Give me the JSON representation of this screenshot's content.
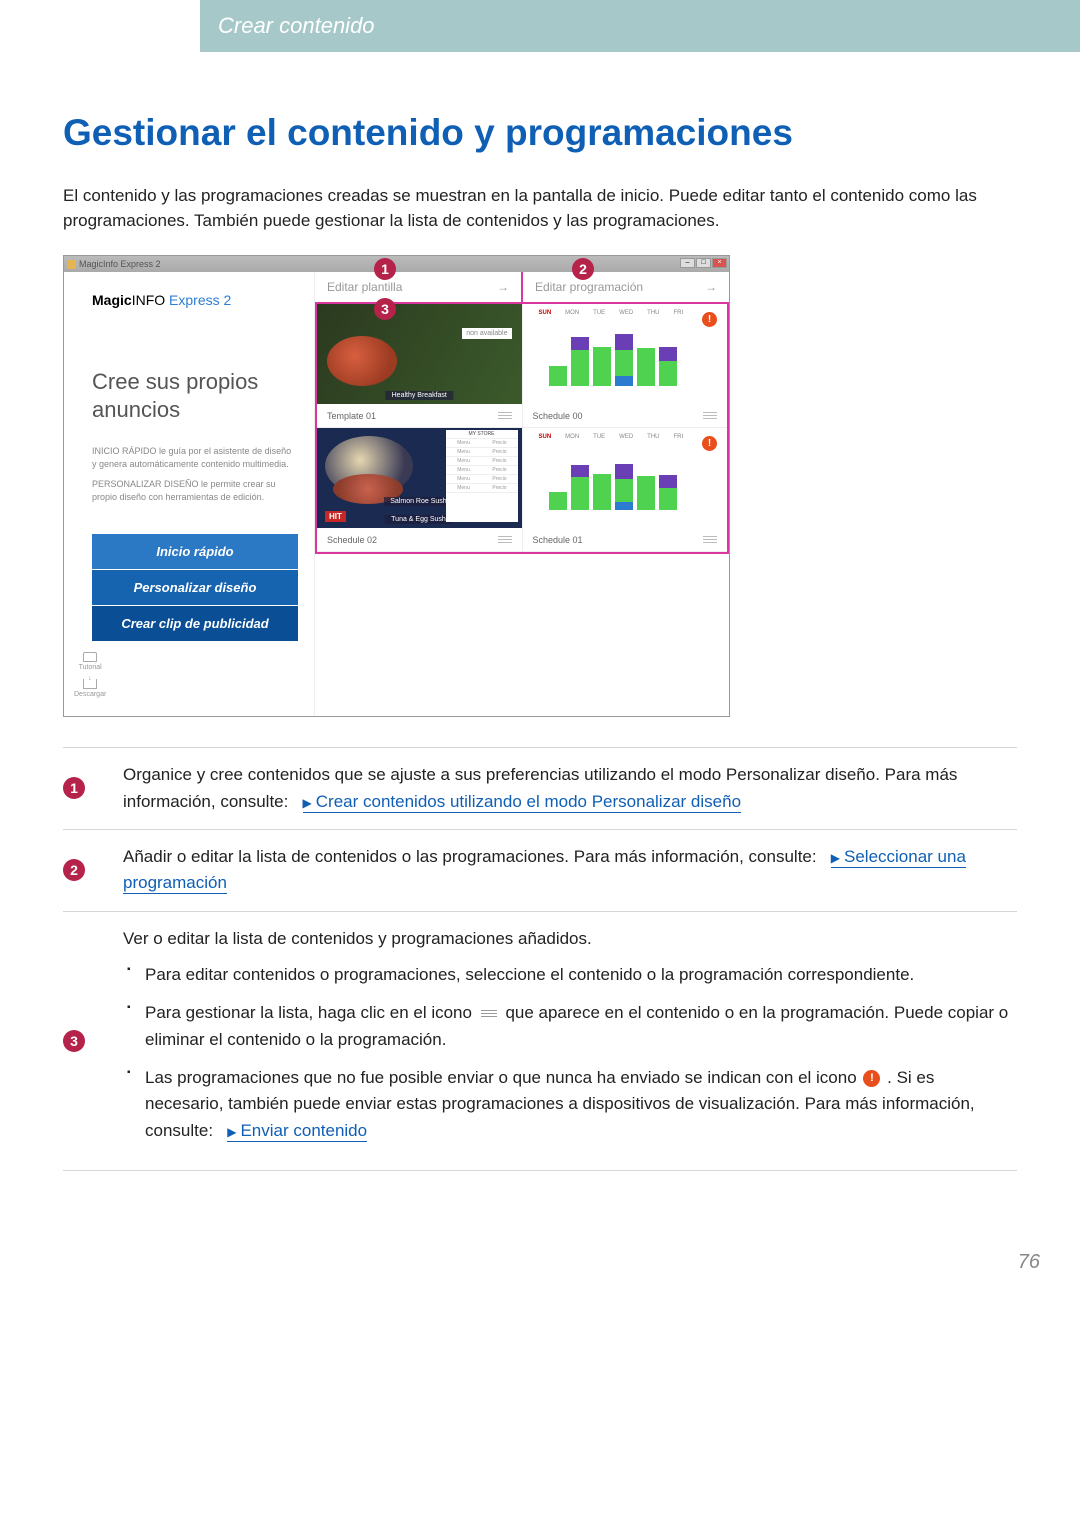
{
  "header": {
    "breadcrumb": "Crear contenido"
  },
  "page": {
    "title": "Gestionar el contenido y programaciones",
    "intro": "El contenido y las programaciones creadas se muestran en la pantalla de inicio. Puede editar tanto el contenido como las programaciones. También puede gestionar la lista de contenidos y las programaciones.",
    "number": "76"
  },
  "screenshot": {
    "titlebar": "MagicInfo Express 2",
    "logo_bold": "Magic",
    "logo_mid": "INFO",
    "logo_brand": " Express 2",
    "slogan": "Cree sus propios anuncios",
    "desc1": "INICIO RÁPIDO le guía por el asistente de diseño y genera automáticamente contenido multimedia.",
    "desc2": "PERSONALIZAR DISEÑO le permite crear su propio diseño con herramientas de edición.",
    "buttons": {
      "b1": "Inicio rápido",
      "b2": "Personalizar diseño",
      "b3": "Crear clip de publicidad"
    },
    "side_icons": {
      "tutorial": "Tutorial",
      "download": "Descargar"
    },
    "tabs": {
      "t1": "Editar plantilla",
      "t2": "Editar programación"
    },
    "cards": {
      "template01": "Template 01",
      "schedule02": "Schedule 02",
      "schedule00": "Schedule 00",
      "schedule01": "Schedule 01",
      "breakfast": "Healthy Breakfast",
      "salmon": "Salmon Roe Sushi",
      "tuna": "Tuna & Egg Sushi",
      "mystore": "MY STORE",
      "non_avail": "non available",
      "days": [
        "SUN",
        "MON",
        "TUE",
        "WED",
        "THU",
        "FRI"
      ]
    }
  },
  "explain": {
    "e1_a": "Organice y cree contenidos que se ajuste a sus preferencias utilizando el modo Personalizar diseño. Para más información, consulte:",
    "e1_link": "Crear contenidos utilizando el modo Personalizar diseño",
    "e2_a": "Añadir o editar la lista de contenidos o las programaciones. Para más información, consulte:",
    "e2_link": "Seleccionar una programación",
    "e3_intro": "Ver o editar la lista de contenidos y programaciones añadidos.",
    "e3_b1": "Para editar contenidos o programaciones, seleccione el contenido o la programación correspondiente.",
    "e3_b2a": "Para gestionar la lista, haga clic en el icono",
    "e3_b2b": "que aparece en el contenido o en la programación. Puede copiar o eliminar el contenido o la programación.",
    "e3_b3a": "Las programaciones que no fue posible enviar o que nunca ha enviado se indican con el icono",
    "e3_b3b": ". Si es necesario, también puede enviar estas programaciones a dispositivos de visualización. Para más información, consulte:",
    "e3_link": "Enviar contenido"
  },
  "chart_data": [
    {
      "type": "bar",
      "title": "Schedule 00",
      "categories": [
        "SUN",
        "MON",
        "TUE",
        "WED",
        "THU",
        "FRI"
      ],
      "series": [
        {
          "name": "seg-purple",
          "color": "#6a3eb5",
          "values": [
            0,
            20,
            0,
            25,
            0,
            22
          ]
        },
        {
          "name": "seg-green",
          "color": "#4fd24f",
          "values": [
            30,
            55,
            60,
            40,
            58,
            38
          ]
        },
        {
          "name": "seg-blue",
          "color": "#2b7bd1",
          "values": [
            0,
            0,
            0,
            15,
            0,
            0
          ]
        }
      ],
      "ylim": [
        0,
        100
      ]
    },
    {
      "type": "bar",
      "title": "Schedule 01",
      "categories": [
        "SUN",
        "MON",
        "TUE",
        "WED",
        "THU",
        "FRI"
      ],
      "series": [
        {
          "name": "seg-purple",
          "color": "#6a3eb5",
          "values": [
            0,
            18,
            0,
            22,
            0,
            20
          ]
        },
        {
          "name": "seg-green",
          "color": "#4fd24f",
          "values": [
            28,
            50,
            55,
            36,
            52,
            34
          ]
        },
        {
          "name": "seg-blue",
          "color": "#2b7bd1",
          "values": [
            0,
            0,
            0,
            12,
            0,
            0
          ]
        }
      ],
      "ylim": [
        0,
        100
      ]
    }
  ]
}
